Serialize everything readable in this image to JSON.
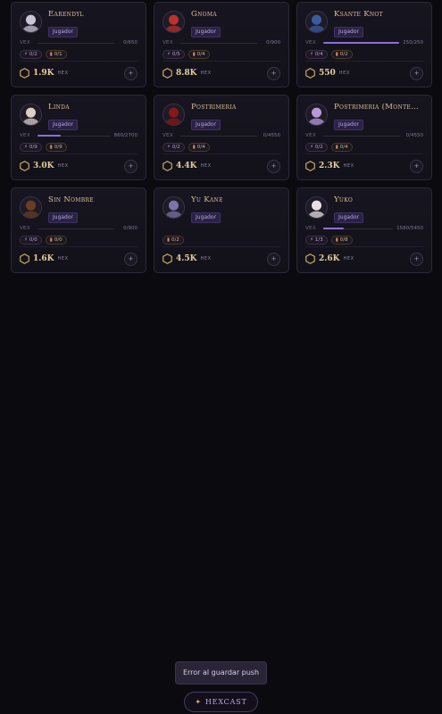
{
  "vex_label": "VEX",
  "hex_unit": "HEX",
  "plus_label": "+",
  "players": [
    {
      "name": "Earendyl",
      "role": "Jugador",
      "vex": "0/650",
      "vex_progress": 0,
      "bolt": "0/2",
      "card": "0/1",
      "hex": "1.9K",
      "avatar_color": "#c9c6d6"
    },
    {
      "name": "Gnoma",
      "role": "Jugador",
      "vex": "0/900",
      "vex_progress": 0,
      "bolt": "0/5",
      "card": "0/4",
      "hex": "8.8K",
      "avatar_color": "#b8322e"
    },
    {
      "name": "Ksante Knot",
      "role": "Jugador",
      "vex": "250/250",
      "vex_progress": 1,
      "bolt": "0/4",
      "card": "0/2",
      "hex": "550",
      "avatar_color": "#3b5aa0"
    },
    {
      "name": "Linda",
      "role": "Jugador",
      "vex": "860/2700",
      "vex_progress": 0.32,
      "bolt": "0/9",
      "card": "0/9",
      "hex": "3.0K",
      "avatar_color": "#d9cfc6"
    },
    {
      "name": "Postrimeria",
      "role": "Jugador",
      "vex": "0/4550",
      "vex_progress": 0,
      "bolt": "0/2",
      "card": "0/4",
      "hex": "4.4K",
      "avatar_color": "#8a1717"
    },
    {
      "name": "Postrimeria (Monten…",
      "role": "Jugador",
      "vex": "0/4550",
      "vex_progress": 0,
      "bolt": "0/2",
      "card": "0/4",
      "hex": "2.3K",
      "avatar_color": "#b799d9"
    },
    {
      "name": "Sin Nombre",
      "role": "Jugador",
      "vex": "0/900",
      "vex_progress": 0,
      "bolt": "0/0",
      "card": "0/0",
      "hex": "1.6K",
      "avatar_color": "#6b3e1f"
    },
    {
      "name": "Yu Kane",
      "role": "Jugador",
      "vex": "",
      "vex_progress": null,
      "bolt": "",
      "card": "0/2",
      "hex": "4.5K",
      "avatar_color": "#7a74a8"
    },
    {
      "name": "Yuko",
      "role": "Jugador",
      "vex": "1580/5450",
      "vex_progress": 0.29,
      "bolt": "1/3",
      "card": "0/8",
      "hex": "2.6K",
      "avatar_color": "#e6dfe3"
    }
  ],
  "error_button": "Error al guardar push",
  "brand": {
    "icon": "star-icon",
    "label": "HEXCAST"
  },
  "colors": {
    "accent": "#8d6fd8",
    "gold": "#e3cf9d",
    "background": "#0b0a0f"
  }
}
